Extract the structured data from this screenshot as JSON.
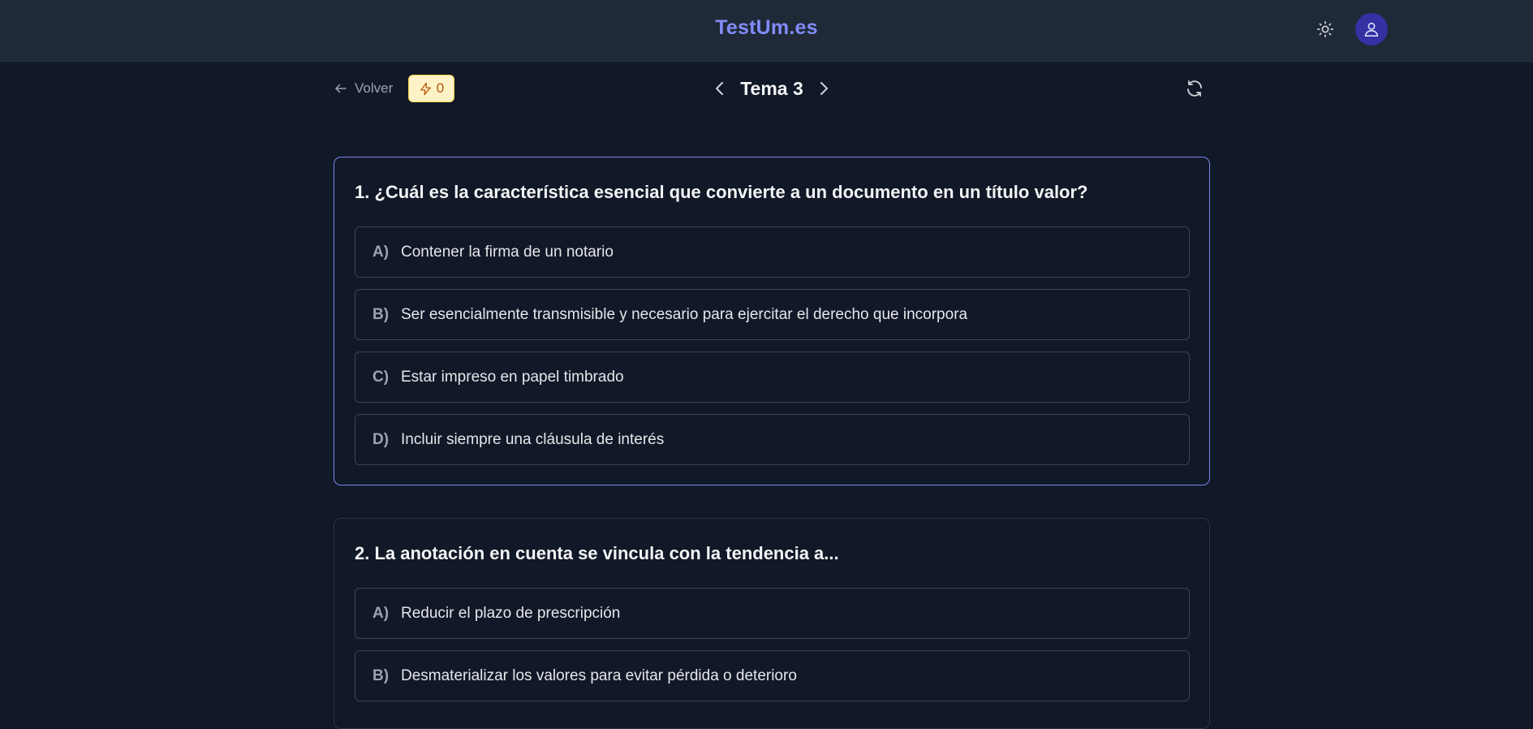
{
  "header": {
    "brand": "TestUm.es",
    "theme_icon": "sun-icon",
    "avatar_icon": "user-icon"
  },
  "toolbar": {
    "back_label": "Volver",
    "streak_value": "0",
    "topic_title": "Tema 3"
  },
  "colors": {
    "accent": "#818cf8",
    "background": "#111827",
    "header": "#1f2937",
    "streak_bg": "#fef3c7"
  },
  "questions": [
    {
      "text": "1. ¿Cuál es la característica esencial que convierte a un documento en un título valor?",
      "options": [
        {
          "letter": "A)",
          "text": "Contener la firma de un notario"
        },
        {
          "letter": "B)",
          "text": "Ser esencialmente transmisible y necesario para ejercitar el derecho que incorpora"
        },
        {
          "letter": "C)",
          "text": "Estar impreso en papel timbrado"
        },
        {
          "letter": "D)",
          "text": "Incluir siempre una cláusula de interés"
        }
      ]
    },
    {
      "text": "2. La anotación en cuenta se vincula con la tendencia a...",
      "options": [
        {
          "letter": "A)",
          "text": "Reducir el plazo de prescripción"
        },
        {
          "letter": "B)",
          "text": "Desmaterializar los valores para evitar pérdida o deterioro"
        }
      ]
    }
  ]
}
